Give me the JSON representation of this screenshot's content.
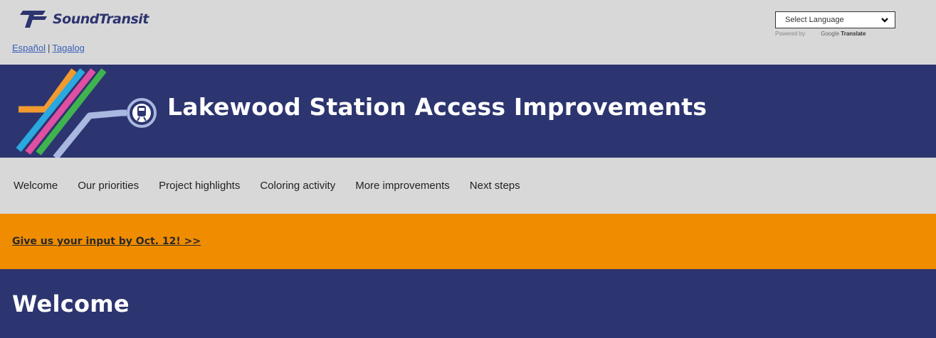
{
  "header": {
    "logo_text": "SoundTransit",
    "lang_links": [
      "Español",
      "Tagalog"
    ],
    "lang_separator": "|"
  },
  "translate": {
    "select_label": "Select Language",
    "powered_by": "Powered by",
    "google": "Google",
    "translate": "Translate"
  },
  "banner": {
    "title": "Lakewood Station Access Improvements",
    "stripe_colors": [
      "#f29a2e",
      "#2aa9e0",
      "#e04fa3",
      "#3fb34f",
      "#a8b8e0"
    ]
  },
  "nav": {
    "items": [
      "Welcome",
      "Our priorities",
      "Project highlights",
      "Coloring activity",
      "More improvements",
      "Next steps"
    ]
  },
  "notice": {
    "text": "Give us your input by Oct. 12! >>"
  },
  "welcome": {
    "heading": "Welcome"
  },
  "colors": {
    "navy": "#2d3570",
    "orange": "#f08c00",
    "gray": "#d8d8d8"
  }
}
